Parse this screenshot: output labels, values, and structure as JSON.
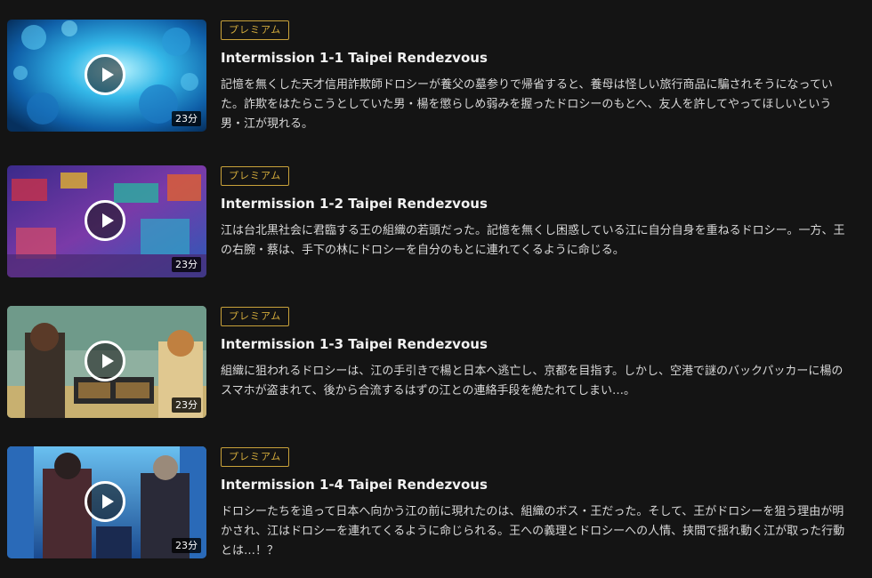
{
  "episodes": [
    {
      "badge": "プレミアム",
      "title": "Intermission 1-1 Taipei Rendezvous",
      "duration": "23分",
      "description": "記憶を無くした天才信用詐欺師ドロシーが養父の墓参りで帰省すると、養母は怪しい旅行商品に騙されそうになっていた。詐欺をはたらこうとしていた男・楊を懲らしめ弱みを握ったドロシーのもとへ、友人を許してやってほしいという男・江が現れる。",
      "thumb_color": "#1c8fd0"
    },
    {
      "badge": "プレミアム",
      "title": "Intermission 1-2 Taipei Rendezvous",
      "duration": "23分",
      "description": "江は台北黒社会に君臨する王の組織の若頭だった。記憶を無くし困惑している江に自分自身を重ねるドロシー。一方、王の右腕・蔡は、手下の林にドロシーを自分のもとに連れてくるように命じる。",
      "thumb_color": "#6a3fb0"
    },
    {
      "badge": "プレミアム",
      "title": "Intermission 1-3 Taipei Rendezvous",
      "duration": "23分",
      "description": "組織に狙われるドロシーは、江の手引きで楊と日本へ逃亡し、京都を目指す。しかし、空港で謎のバックパッカーに楊のスマホが盗まれて、後から合流するはずの江との連絡手段を絶たれてしまい…。",
      "thumb_color": "#7fa08a"
    },
    {
      "badge": "プレミアム",
      "title": "Intermission 1-4 Taipei Rendezvous",
      "duration": "23分",
      "description": "ドロシーたちを追って日本へ向かう江の前に現れたのは、組織のボス・王だった。そして、王がドロシーを狙う理由が明かされ、江はドロシーを連れてくるように命じられる。王への義理とドロシーへの人情、挟間で揺れ動く江が取った行動とは…！？",
      "thumb_color": "#2f86d6"
    }
  ]
}
